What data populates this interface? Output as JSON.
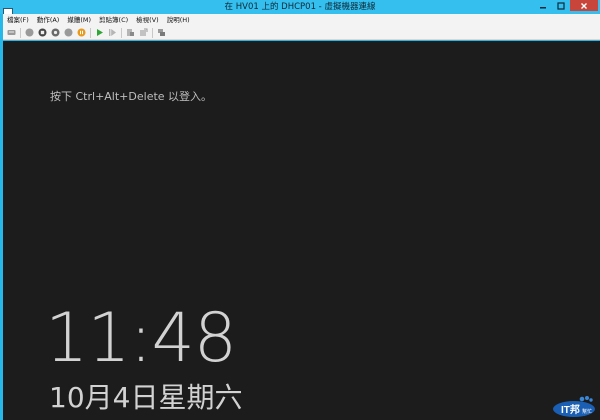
{
  "window": {
    "title": "在 HV01 上的 DHCP01 - 虛擬機器連線"
  },
  "menu": [
    "檔案(F)",
    "動作(A)",
    "媒體(M)",
    "剪貼簿(C)",
    "檢視(V)",
    "說明(H)"
  ],
  "toolbar": {
    "icons": [
      "ctrl-alt-del-icon",
      "start-icon",
      "turn-off-icon",
      "shut-down-icon",
      "save-icon",
      "pause-icon",
      "resume-icon",
      "reset-icon",
      "checkpoint-icon",
      "revert-icon",
      "enhanced-session-icon"
    ]
  },
  "lockscreen": {
    "prompt": "按下 Ctrl+Alt+Delete 以登入。",
    "time": "11:48",
    "date": "10月4日星期六"
  },
  "watermark": {
    "brand": "IT邦",
    "sub": "幫忙"
  },
  "colors": {
    "titlebar": "#34bfee",
    "close": "#c7453a",
    "screen": "#1c1c1c",
    "text": "#d2d2d2"
  }
}
